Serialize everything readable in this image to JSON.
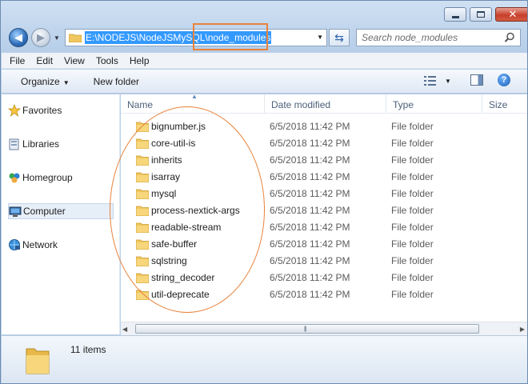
{
  "window": {
    "buttons": {
      "minimize": "minimize",
      "maximize": "maximize",
      "close": "close"
    }
  },
  "address": {
    "path": "E:\\NODEJS\\NodeJSMySQL\\node_modules"
  },
  "search": {
    "placeholder": "Search node_modules"
  },
  "menu": [
    "File",
    "Edit",
    "View",
    "Tools",
    "Help"
  ],
  "toolbar": {
    "organize": "Organize",
    "new_folder": "New folder"
  },
  "nav": [
    {
      "label": "Favorites",
      "icon": "star-icon"
    },
    {
      "label": "Libraries",
      "icon": "libraries-icon"
    },
    {
      "label": "Homegroup",
      "icon": "homegroup-icon"
    },
    {
      "label": "Computer",
      "icon": "computer-icon",
      "selected": true
    },
    {
      "label": "Network",
      "icon": "network-icon"
    }
  ],
  "columns": {
    "name": "Name",
    "date": "Date modified",
    "type": "Type",
    "size": "Size"
  },
  "files": [
    {
      "name": "bignumber.js",
      "date": "6/5/2018 11:42 PM",
      "type": "File folder"
    },
    {
      "name": "core-util-is",
      "date": "6/5/2018 11:42 PM",
      "type": "File folder"
    },
    {
      "name": "inherits",
      "date": "6/5/2018 11:42 PM",
      "type": "File folder"
    },
    {
      "name": "isarray",
      "date": "6/5/2018 11:42 PM",
      "type": "File folder"
    },
    {
      "name": "mysql",
      "date": "6/5/2018 11:42 PM",
      "type": "File folder"
    },
    {
      "name": "process-nextick-args",
      "date": "6/5/2018 11:42 PM",
      "type": "File folder"
    },
    {
      "name": "readable-stream",
      "date": "6/5/2018 11:42 PM",
      "type": "File folder"
    },
    {
      "name": "safe-buffer",
      "date": "6/5/2018 11:42 PM",
      "type": "File folder"
    },
    {
      "name": "sqlstring",
      "date": "6/5/2018 11:42 PM",
      "type": "File folder"
    },
    {
      "name": "string_decoder",
      "date": "6/5/2018 11:42 PM",
      "type": "File folder"
    },
    {
      "name": "util-deprecate",
      "date": "6/5/2018 11:42 PM",
      "type": "File folder"
    }
  ],
  "details": {
    "count": "11 items"
  },
  "colors": {
    "accent": "#3399ff",
    "annotation": "#e9823b",
    "folder": "#f0c75e"
  }
}
